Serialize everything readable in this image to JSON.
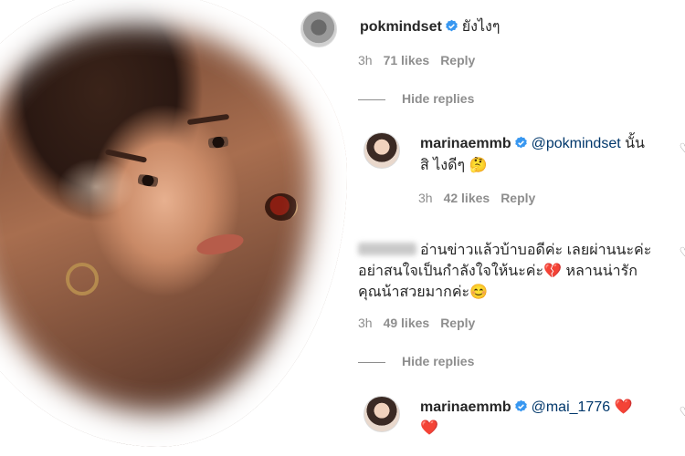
{
  "comments": [
    {
      "username": "pokmindset",
      "text": "ยังไงๆ",
      "time": "3h",
      "likes": "71 likes",
      "reply": "Reply"
    },
    {
      "username": "marinaemmb",
      "mention": "@pokmindset",
      "text_line1": "นั้น",
      "text_line2": "สิ ไงดีๆ 🤔",
      "time": "3h",
      "likes": "42 likes",
      "reply": "Reply"
    },
    {
      "username_hidden": "mai_1776",
      "line1": "อ่านข่าวแล้วบ้าบอดีค่ะ เลยผ่านนะค่ะ",
      "line2": "อย่าสนใจเป็นกำลังใจให้นะค่ะ💔  หลานน่ารัก",
      "line3": "คุณน้าสวยมากค่ะ😊",
      "time": "3h",
      "likes": "49 likes",
      "reply": "Reply"
    },
    {
      "username": "marinaemmb",
      "mention": "@mai_1776",
      "hearts": "❤️",
      "hearts2": "❤️"
    }
  ],
  "hide_replies": "Hide replies",
  "colors": {
    "verified": "#3897f0",
    "mention": "#00376b",
    "meta": "#8e8e8e"
  }
}
